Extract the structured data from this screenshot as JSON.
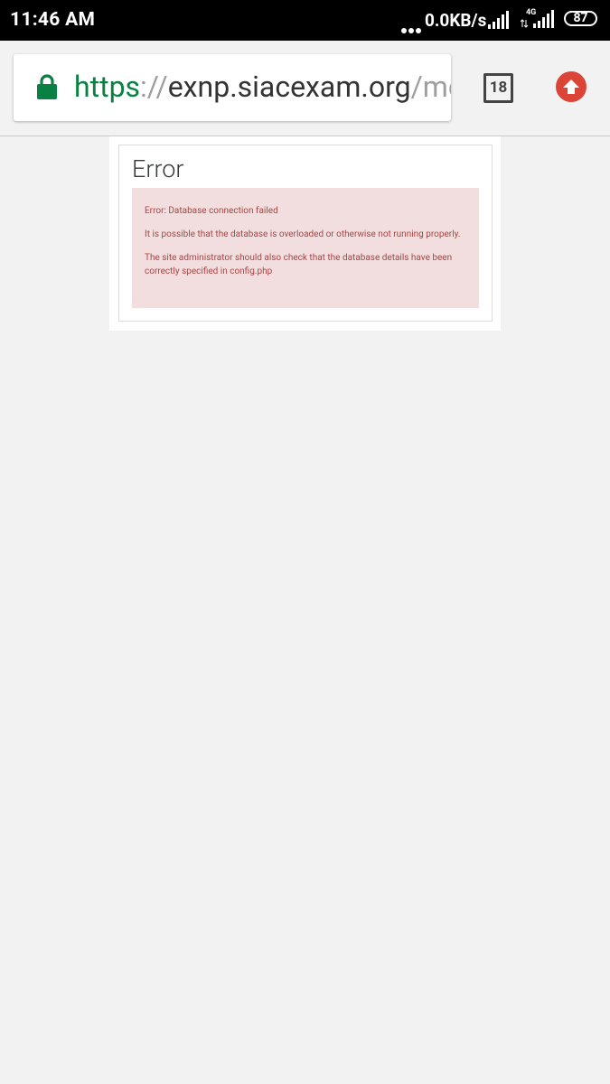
{
  "status_bar": {
    "time": "11:46 AM",
    "network_speed": "0.0KB/s",
    "network_type": "4G",
    "battery": "87"
  },
  "browser": {
    "url_scheme": "https",
    "url_separator": "://",
    "url_host": "exnp.siacexam.org",
    "url_path": "/mc",
    "tab_count": "18",
    "icons": [
      "lock-icon",
      "tab-switcher-icon",
      "upload-arrow-icon"
    ],
    "colors": {
      "secure": "#0b8043",
      "upload_button": "#db4437"
    }
  },
  "page": {
    "title": "Error",
    "messages": [
      "Error: Database connection failed",
      "It is possible that the database is overloaded or otherwise not running properly.",
      "The site administrator should also check that the database details have been correctly specified in config.php"
    ],
    "colors": {
      "alert_bg": "#f2dede",
      "alert_text": "#a94442"
    }
  }
}
